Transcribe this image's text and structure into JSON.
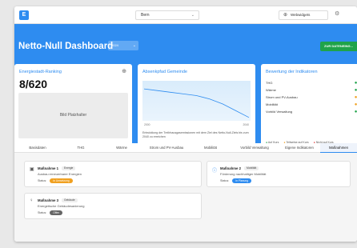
{
  "topbar": {
    "logo_text": "E",
    "city_value": "Bern",
    "widgets_label": "Webwidgets"
  },
  "header": {
    "title": "Netto-Null Dashboard",
    "year_value": "2024",
    "data_button_label": "ZUR DATENEING..."
  },
  "cards": {
    "ranking": {
      "title": "Energiestadt-Ranking",
      "rank": "8/620",
      "placeholder": "Bild Platzhalter"
    },
    "reduction_path": {
      "title": "Absenkpfad Gemeinde",
      "note": "Entwicklung der Treibhausgasemissionen mit dem Ziel des Netto-Null-Ziels bis zum 2040 zu erreichen"
    },
    "indicators": {
      "title": "Bewertung der Indikatoren",
      "rows": [
        {
          "label": "THG",
          "status": "green"
        },
        {
          "label": "Wärme",
          "status": "green"
        },
        {
          "label": "Strom und PV-Ausbau",
          "status": "yellow"
        },
        {
          "label": "Mobilität",
          "status": "yellow"
        },
        {
          "label": "Vorbild Verwaltung",
          "status": "green"
        }
      ],
      "legend": [
        "Auf Kurs",
        "Teilweise auf Kurs",
        "Nicht auf Kurs"
      ]
    }
  },
  "chart_data": {
    "type": "area",
    "title": "Absenkpfad Gemeinde",
    "x": [
      2000,
      2005,
      2010,
      2015,
      2020,
      2025,
      2030,
      2035,
      2040
    ],
    "tick_labels": [
      "2000",
      "2040"
    ],
    "series": [
      {
        "values": [
          95,
          90,
          85,
          80,
          75,
          65,
          50,
          30,
          10
        ]
      }
    ]
  },
  "tabs": [
    {
      "label": "Basisdaten"
    },
    {
      "label": "THG"
    },
    {
      "label": "Wärme"
    },
    {
      "label": "Strom und PV-Ausbau"
    },
    {
      "label": "Mobilität"
    },
    {
      "label": "Vorbild Verwaltung"
    },
    {
      "label": "Eigene Indikatoren"
    },
    {
      "label": "Maßnahmen"
    }
  ],
  "measures": [
    {
      "title": "Maßnahme 1",
      "tag": "Energie",
      "subtitle": "Ausbau erneuerbarer Energien",
      "status_label": "Status:",
      "status": "In Umsetzung",
      "color": "#f0a020"
    },
    {
      "title": "Maßnahme 2",
      "tag": "Mobilität",
      "subtitle": "Förderung nachhaltiger Mobilität",
      "status_label": "Status:",
      "status": "In Planung",
      "color": "#2e8cf0"
    },
    {
      "title": "Maßnahme 3",
      "tag": "Gebäude",
      "subtitle": "Energetische Gebäudesanierung",
      "status_label": "Status:",
      "status": "Offen",
      "color": "#666666"
    }
  ],
  "colors": {
    "brand": "#2e8cf0",
    "success": "#1fa34a",
    "warning": "#f0a020",
    "danger": "#e03131"
  }
}
